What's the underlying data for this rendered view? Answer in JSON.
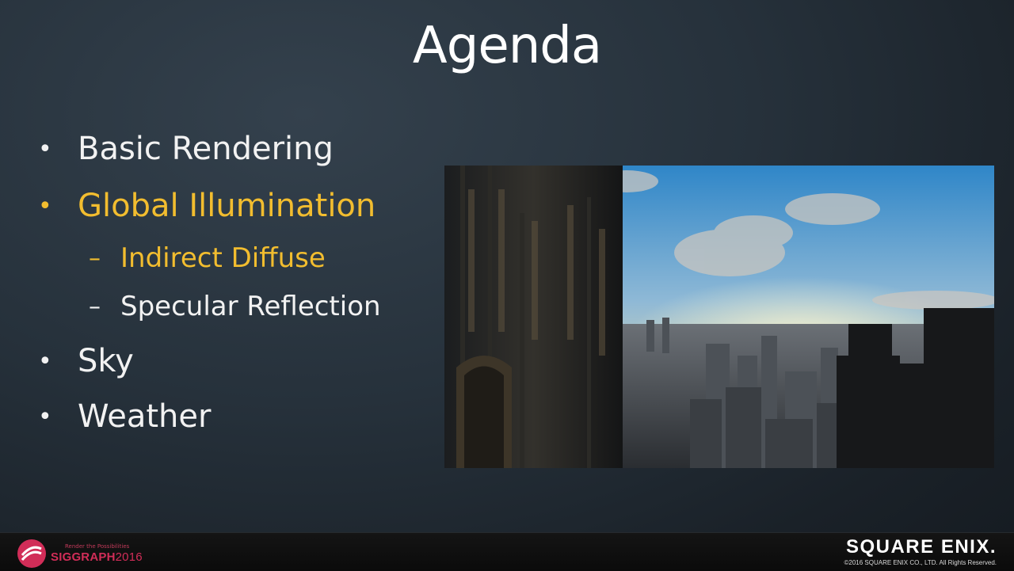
{
  "slide": {
    "title": "Agenda",
    "bullets": [
      {
        "marker": "•",
        "text": "Basic Rendering",
        "level": 1,
        "highlighted": false
      },
      {
        "marker": "•",
        "text": "Global Illumination",
        "level": 1,
        "highlighted": true
      },
      {
        "marker": "–",
        "text": "Indirect Diffuse",
        "level": 2,
        "highlighted": true
      },
      {
        "marker": "–",
        "text": "Specular Reflection",
        "level": 2,
        "highlighted": false
      },
      {
        "marker": "•",
        "text": "Sky",
        "level": 1,
        "highlighted": false
      },
      {
        "marker": "•",
        "text": "Weather",
        "level": 1,
        "highlighted": false
      }
    ]
  },
  "image": {
    "description_icon": "city-skyline-image"
  },
  "footer": {
    "left_logo": {
      "tagline": "Render the Possibilities",
      "name": "SIGGRAPH",
      "year": "2016"
    },
    "right_logo": {
      "name": "SQUARE ENIX.",
      "copyright": "©2016 SQUARE ENIX CO., LTD. All Rights Reserved."
    }
  },
  "colors": {
    "highlight": "#f2bd2f",
    "text": "#f2f2f2",
    "siggraph": "#d12d58"
  }
}
